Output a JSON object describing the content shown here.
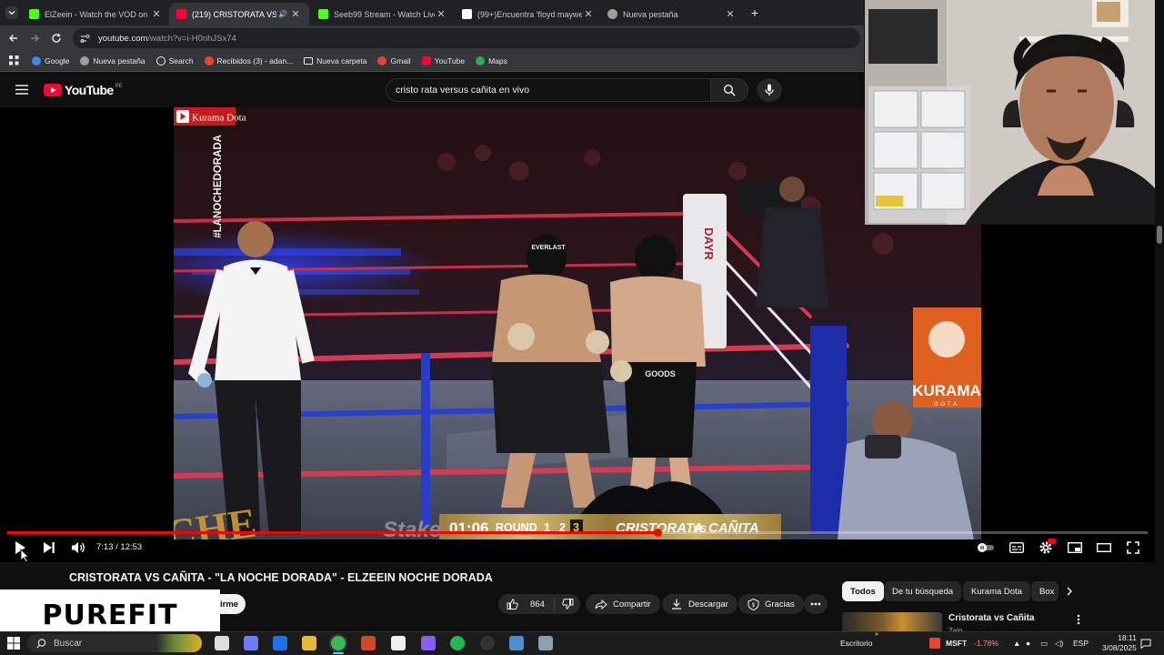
{
  "browser": {
    "tabs": [
      {
        "title": "ElZeein - Watch the VOD on Ki",
        "favicon": "kick-icon",
        "color": "#53fc18",
        "active": false
      },
      {
        "title": "(219) CRISTORATA VS CAÑ",
        "favicon": "youtube-icon",
        "color": "#ff0033",
        "active": true,
        "audio": true
      },
      {
        "title": "Seeb99 Stream - Watch Live on",
        "favicon": "kick-icon",
        "color": "#53fc18",
        "active": false
      },
      {
        "title": "(99+)Encuentra 'floyd mayweat",
        "favicon": "tiktok-icon",
        "color": "#ffffff",
        "active": false
      },
      {
        "title": "Nueva pestaña",
        "favicon": "chrome-icon",
        "color": "#9aa0a6",
        "active": false
      }
    ],
    "url_host": "youtube.com",
    "url_path": "/watch?v=i-H0nhJSx74",
    "bookmarks": [
      {
        "label": "Google",
        "icon": "google-icon",
        "color": "#4285f4"
      },
      {
        "label": "Nueva pestaña",
        "icon": "chrome-icon",
        "color": "#9aa0a6"
      },
      {
        "label": "Search",
        "icon": "search-icon",
        "color": "#e8eaed"
      },
      {
        "label": "Recibidos (3) - adan...",
        "icon": "gmail-icon",
        "color": "#ea4335"
      },
      {
        "label": "Nueva carpeta",
        "icon": "folder-icon",
        "color": "#e8eaed"
      },
      {
        "label": "Gmail",
        "icon": "gmail-icon",
        "color": "#ea4335"
      },
      {
        "label": "YouTube",
        "icon": "youtube-icon",
        "color": "#ff0033"
      },
      {
        "label": "Maps",
        "icon": "maps-icon",
        "color": "#34a853"
      }
    ]
  },
  "youtube": {
    "logo_text": "YouTube",
    "region": "PE",
    "search_query": "cristo rata versus cañita en vivo"
  },
  "video": {
    "channel_watermark": "Kurama Dota",
    "hashtag": "#LANOCHEDORADA",
    "scoreboard": {
      "clock": "01:06",
      "round_label": "ROUND",
      "rounds": [
        "1",
        "2",
        "3"
      ],
      "matchup_left": "CRISTORATA",
      "matchup_vs": "VS",
      "matchup_right": "CAÑITA"
    },
    "sponsor": "Stake",
    "side_logo": "KURAMA",
    "side_logo_sub": "DOTA",
    "trunks": "GOODS",
    "glove_brand": "EVERLAST",
    "corner_pad": "DAYR",
    "progress": 0.57,
    "time": "7:13 / 12:53",
    "title": "CRISTORATA VS CAÑITA - \"LA NOCHE DORADA\" - ELZEEIN NOCHE DORADA"
  },
  "actions": {
    "subscribe_partial": "irme",
    "likes": "864",
    "share": "Compartir",
    "download": "Descargar",
    "thanks": "Gracias"
  },
  "sidebar": {
    "chips": [
      "Todos",
      "De tu búsqueda",
      "Kurama Dota",
      "Box"
    ],
    "first_video": "Cristorata vs Cañita",
    "first_video_channel": "Zein"
  },
  "overlay_brand": "PUREFIT",
  "taskbar": {
    "search_placeholder": "Buscar",
    "desktop_label": "Escritorio",
    "stock_symbol": "MSFT",
    "stock_change": "-1.78%",
    "language": "ESP",
    "clock_time": "18:11",
    "clock_date": "3/08/2025"
  }
}
